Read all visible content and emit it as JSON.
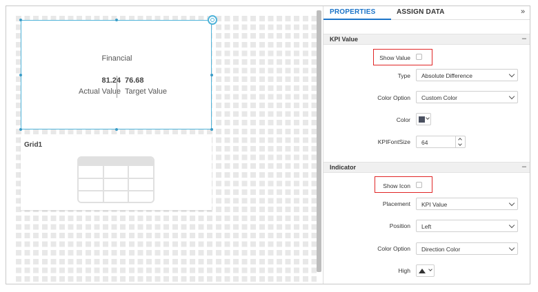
{
  "kpi_card": {
    "title": "Financial",
    "actual_value": "81.24",
    "actual_label": "Actual Value",
    "target_value": "76.68",
    "target_label": "Target Value"
  },
  "grid_card": {
    "title": "Grid1"
  },
  "panel": {
    "tabs": {
      "properties": "PROPERTIES",
      "assign_data": "ASSIGN DATA",
      "expand": "»"
    },
    "kpi_section": {
      "title": "KPI Value",
      "collapse": "–",
      "show_value_label": "Show Value",
      "show_value_checked": false,
      "type_label": "Type",
      "type_value": "Absolute Difference",
      "color_option_label": "Color Option",
      "color_option_value": "Custom Color",
      "color_label": "Color",
      "color_value": "#4a5060",
      "font_size_label": "KPIFontSize",
      "font_size_value": "64"
    },
    "indicator_section": {
      "title": "Indicator",
      "collapse": "–",
      "show_icon_label": "Show Icon",
      "show_icon_checked": false,
      "placement_label": "Placement",
      "placement_value": "KPI Value",
      "position_label": "Position",
      "position_value": "Left",
      "color_option_label": "Color Option",
      "color_option_value": "Direction Color",
      "high_label": "High",
      "high_icon": "triangle-up-icon"
    }
  },
  "colors": {
    "accent": "#1a73c8",
    "highlight": "#e02424",
    "selection": "#4fb3d9"
  }
}
